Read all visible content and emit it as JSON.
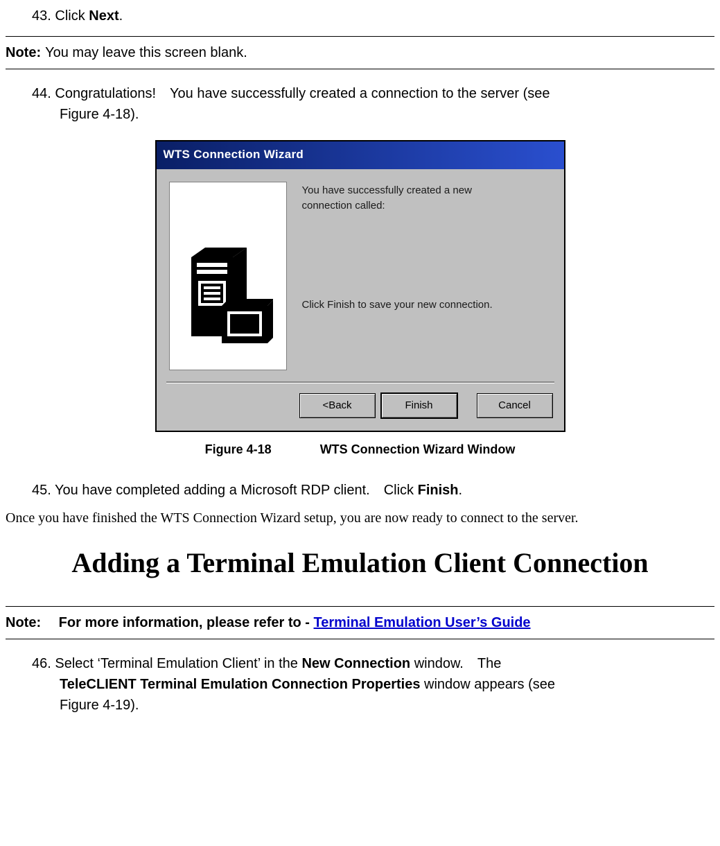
{
  "step43": {
    "num": "43.",
    "pre": "Click ",
    "bold": "Next",
    "post": "."
  },
  "note1": {
    "label": "Note:",
    "text": "You may leave this screen blank."
  },
  "step44": {
    "num": "44.",
    "line1": "Congratulations! You have successfully created a connection to the server (see",
    "line2": "Figure 4-18)."
  },
  "wizard": {
    "title": "WTS Connection Wizard",
    "msg1a": "You have successfully created a new",
    "msg1b": "connection called:",
    "msg2": "Click Finish to save your new connection.",
    "back": "<Back",
    "finish": "Finish",
    "cancel": "Cancel"
  },
  "fig418": {
    "num": "Figure 4-18",
    "title": "WTS Connection Wizard Window"
  },
  "step45": {
    "num": "45.",
    "pre": "You have completed adding a Microsoft RDP client. Click ",
    "bold": "Finish",
    "post": "."
  },
  "para": "Once you have finished the WTS Connection Wizard setup, you are now ready to connect to the server.",
  "h1": "Adding a Terminal Emulation Client Connection",
  "note2": {
    "label": "Note: ",
    "pre": "For more information, please refer to - ",
    "link": "Terminal Emulation User’s Guide"
  },
  "step46": {
    "num": "46.",
    "t1": "Select ‘Terminal Emulation Client’ in the ",
    "b1": "New Connection",
    "t2": " window. The",
    "b2": "TeleCLIENT Terminal Emulation Connection Properties",
    "t3": " window appears (see",
    "t4": "Figure 4-19)."
  }
}
